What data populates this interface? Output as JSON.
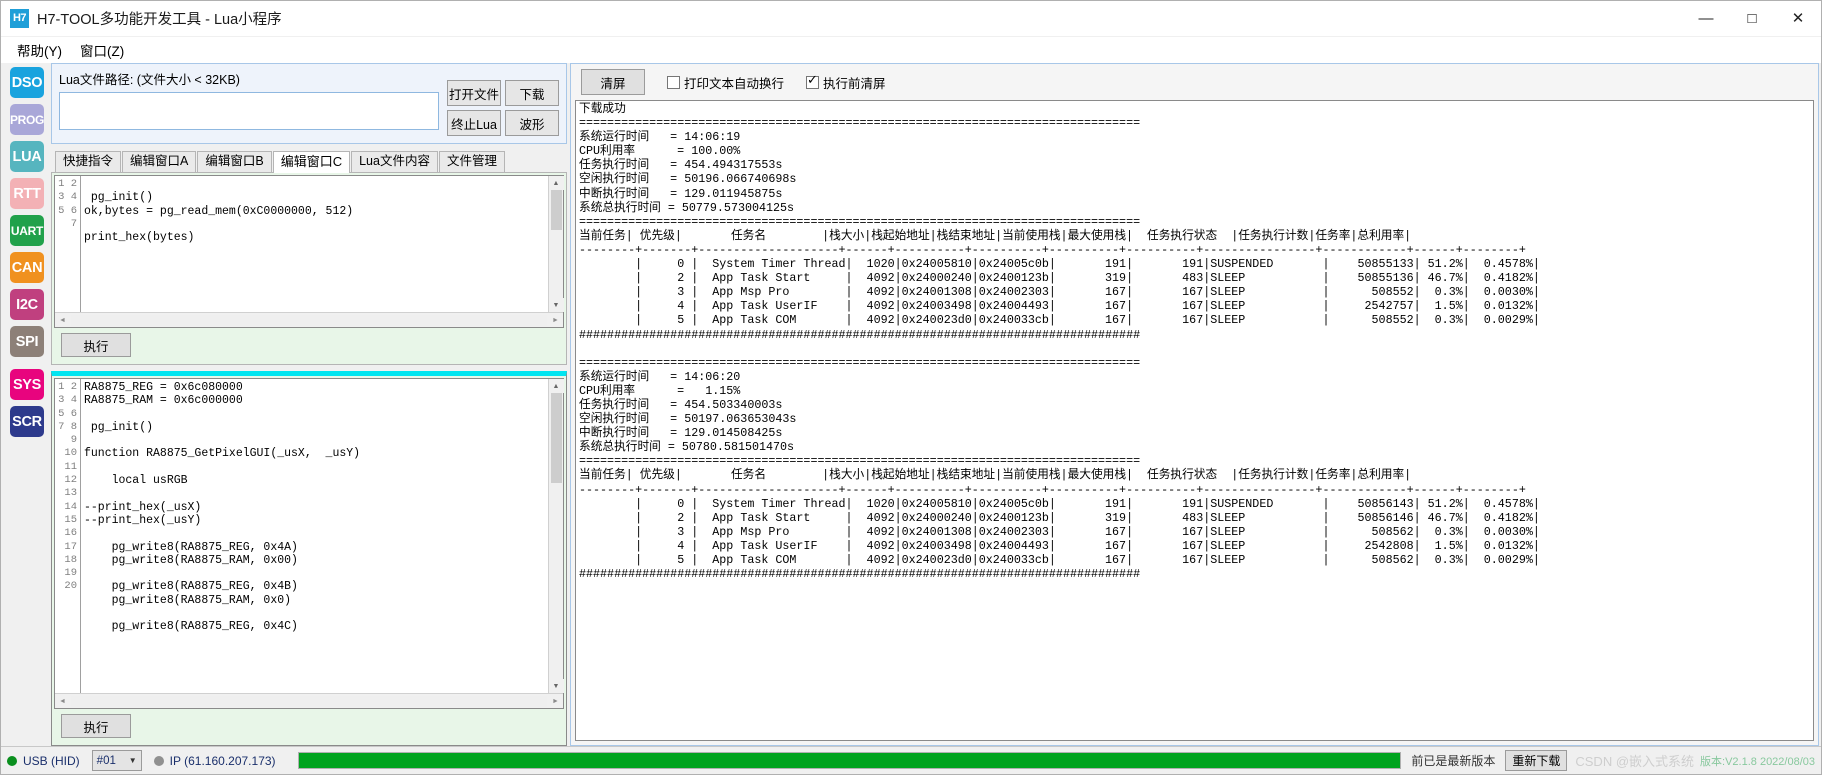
{
  "window": {
    "logo": "H7",
    "title": "H7-TOOL多功能开发工具 - Lua小程序",
    "minimize": "—",
    "maximize": "□",
    "close": "✕"
  },
  "menubar": {
    "items": [
      {
        "label": "帮助(Y)"
      },
      {
        "label": "窗口(Z)"
      }
    ]
  },
  "sidebar": {
    "items": [
      {
        "label": "DSO",
        "color": "#19a3de"
      },
      {
        "label": "PROG",
        "color": "#a9a7d8"
      },
      {
        "label": "LUA",
        "color": "#56b5bf"
      },
      {
        "label": "RTT",
        "color": "#f3b1b5"
      },
      {
        "label": "UART",
        "color": "#21a14b"
      },
      {
        "label": "CAN",
        "color": "#f0911f"
      },
      {
        "label": "I2C",
        "color": "#c0407f"
      },
      {
        "label": "SPI",
        "color": "#8d8078"
      },
      {
        "label": "SYS",
        "color": "#e8047e"
      },
      {
        "label": "SCR",
        "color": "#2d3a8c"
      }
    ]
  },
  "path_panel": {
    "label": "Lua文件路径: (文件大小 < 32KB)",
    "value": "",
    "placeholder": "",
    "buttons": [
      {
        "label": "打开文件"
      },
      {
        "label": "下载"
      },
      {
        "label": "终止Lua"
      },
      {
        "label": "波形"
      }
    ]
  },
  "tabs": {
    "items": [
      {
        "label": "快捷指令",
        "active": false
      },
      {
        "label": "编辑窗口A",
        "active": false
      },
      {
        "label": "编辑窗口B",
        "active": false
      },
      {
        "label": "编辑窗口C",
        "active": true
      },
      {
        "label": "Lua文件内容",
        "active": false
      },
      {
        "label": "文件管理",
        "active": false
      }
    ]
  },
  "editor_top": {
    "line_numbers": "1\n2\n3\n4\n5\n6\n7",
    "code": " pg_init()\nok,bytes = pg_read_mem(0xC0000000, 512)\n\nprint_hex(bytes)",
    "code_offset_lines": 1,
    "exec_label": "执行"
  },
  "editor_bottom": {
    "line_numbers": "1\n2\n3\n4\n5\n6\n7\n8\n9\n10\n11\n12\n13\n14\n15\n16\n17\n18\n19\n20",
    "code": "RA8875_REG = 0x6c080000\nRA8875_RAM = 0x6c000000\n\n pg_init()\n\nfunction RA8875_GetPixelGUI(_usX,  _usY)\n\n    local usRGB\n\n--print_hex(_usX)\n--print_hex(_usY)\n\n    pg_write8(RA8875_REG, 0x4A)\n    pg_write8(RA8875_RAM, 0x00)\n\n    pg_write8(RA8875_REG, 0x4B)\n    pg_write8(RA8875_RAM, 0x0)\n\n    pg_write8(RA8875_REG, 0x4C)",
    "exec_label": "执行"
  },
  "output_panel": {
    "clear_label": "清屏",
    "wrap_checkbox": {
      "label": "打印文本自动换行",
      "checked": false
    },
    "clear_before_run_checkbox": {
      "label": "执行前清屏",
      "checked": true
    },
    "console_text": "下载成功\n================================================================================\n系统运行时间   = 14:06:19\nCPU利用率      = 100.00%\n任务执行时间   = 454.494317553s\n空闲执行时间   = 50196.066740698s\n中断执行时间   = 129.011945875s\n系统总执行时间 = 50779.573004125s\n================================================================================\n当前任务| 优先级|       任务名        |栈大小|栈起始地址|栈结束地址|当前使用栈|最大使用栈|  任务执行状态  |任务执行计数|任务率|总利用率|\n--------+-------+--------------------+------+----------+----------+----------+----------+----------------+------------+------+--------+\n        |     0 |  System Timer Thread|  1020|0x24005810|0x24005c0b|       191|       191|SUSPENDED       |    50855133| 51.2%|  0.4578%|\n        |     2 |  App Task Start     |  4092|0x24000240|0x2400123b|       319|       483|SLEEP           |    50855136| 46.7%|  0.4182%|\n        |     3 |  App Msp Pro        |  4092|0x24001308|0x24002303|       167|       167|SLEEP           |      508552|  0.3%|  0.0030%|\n        |     4 |  App Task UserIF    |  4092|0x24003498|0x24004493|       167|       167|SLEEP           |     2542757|  1.5%|  0.0132%|\n        |     5 |  App Task COM       |  4092|0x240023d0|0x240033cb|       167|       167|SLEEP           |      508552|  0.3%|  0.0029%|\n################################################################################\n\n================================================================================\n系统运行时间   = 14:06:20\nCPU利用率      =   1.15%\n任务执行时间   = 454.503340003s\n空闲执行时间   = 50197.063653043s\n中断执行时间   = 129.014508425s\n系统总执行时间 = 50780.581501470s\n================================================================================\n当前任务| 优先级|       任务名        |栈大小|栈起始地址|栈结束地址|当前使用栈|最大使用栈|  任务执行状态  |任务执行计数|任务率|总利用率|\n--------+-------+--------------------+------+----------+----------+----------+----------+----------------+------------+------+--------+\n        |     0 |  System Timer Thread|  1020|0x24005810|0x24005c0b|       191|       191|SUSPENDED       |    50856143| 51.2%|  0.4578%|\n        |     2 |  App Task Start     |  4092|0x24000240|0x2400123b|       319|       483|SLEEP           |    50856146| 46.7%|  0.4182%|\n        |     3 |  App Msp Pro        |  4092|0x24001308|0x24002303|       167|       167|SLEEP           |      508562|  0.3%|  0.0030%|\n        |     4 |  App Task UserIF    |  4092|0x24003498|0x24004493|       167|       167|SLEEP           |     2542808|  1.5%|  0.0132%|\n        |     5 |  App Task COM       |  4092|0x240023d0|0x240033cb|       167|       167|SLEEP           |      508562|  0.3%|  0.0029%|\n################################################################################"
  },
  "statusbar": {
    "usb": {
      "label": "USB (HID)",
      "led_color": "#0a8f1e"
    },
    "device_select": {
      "value": "#01"
    },
    "ip": {
      "label": "IP (61.160.207.173)",
      "led_color": "#808080"
    },
    "progress": {
      "percent": 100,
      "color": "#00a31e"
    },
    "version_text": "前已是最新版本",
    "redownload_label": "重新下载",
    "watermark": "CSDN @嵌入式系统",
    "watermark2": "版本:V2.1.8  2022/08/03"
  }
}
